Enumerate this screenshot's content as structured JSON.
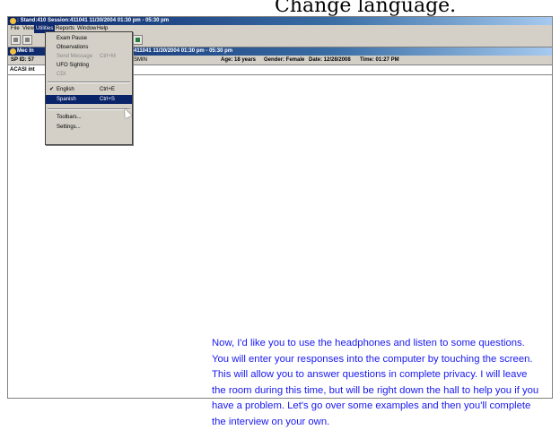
{
  "overlay": {
    "text": "Change language."
  },
  "window": {
    "title": ": Stand:410 Session:411041 11/30/2004 01:30 pm - 05:30 pm"
  },
  "menubar": {
    "file": "File",
    "view": "View",
    "utilities": "Utilities",
    "reports": "Reports",
    "window": "Window",
    "help": "Help"
  },
  "child": {
    "title_prefix": "Mec In",
    "title_tail": "411041 11/30/2004 01:30 pm - 05:30 pm",
    "sp_id": "SP ID: 57",
    "staff": "SMIN",
    "age": "Age: 18 years",
    "gender": "Gender: Female",
    "date": "Date: 12/28/2008",
    "time": "Time: 01:27 PM",
    "acasi": "ACASI int"
  },
  "utilities_menu": {
    "exam_pause": "Exam Pause",
    "observations": "Observations",
    "send_message": "Send Message",
    "send_message_shortcut": "Ctrl+M",
    "ufo_sighting": "UFO Sighting",
    "cdi": "CDI",
    "english": "English",
    "english_shortcut": "Ctrl+E",
    "spanish": "Spanish",
    "spanish_shortcut": "Ctrl+S",
    "toolbars": "Toolbars...",
    "settings": "Settings..."
  },
  "instructions": {
    "line1": "Now, I'd like you to use the headphones and listen to some questions.",
    "line2": "You will enter your responses into the computer by touching the screen.",
    "line3": "This will allow you to answer questions in complete privacy. I will leave",
    "line4": "the room during this time, but will be right down the hall to help you if you",
    "line5": "have a problem. Let's go over some examples and then you'll complete",
    "line6": "the interview on your own."
  }
}
